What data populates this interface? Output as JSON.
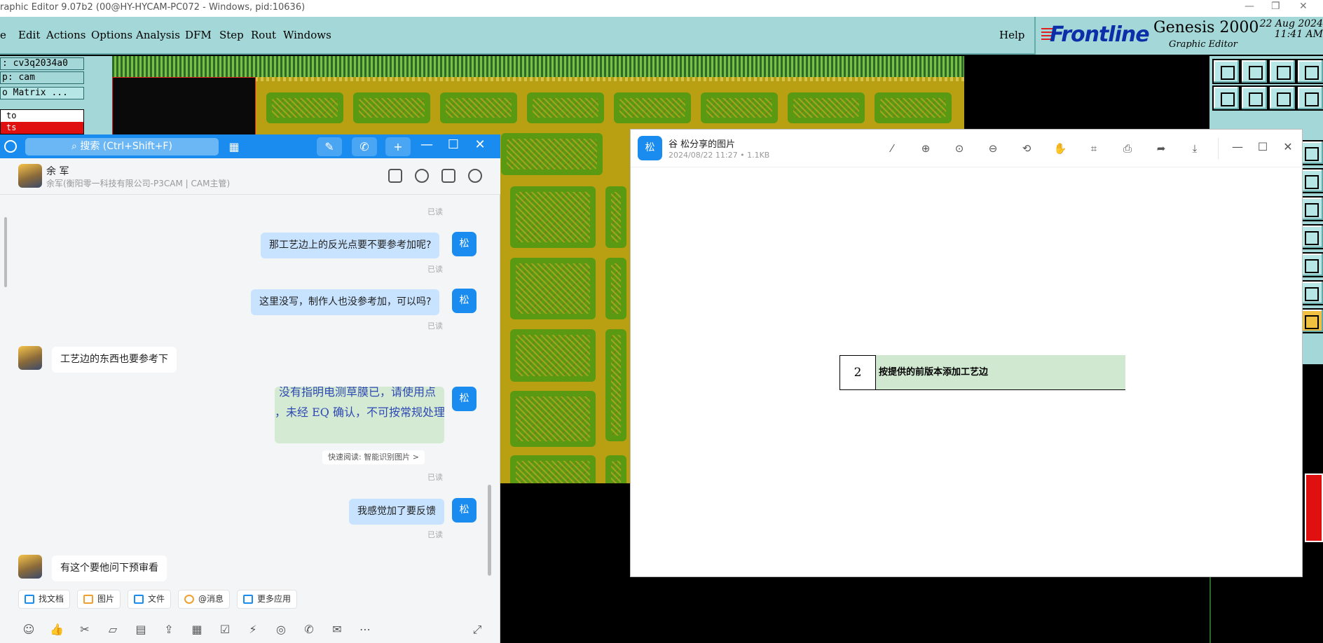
{
  "genesis": {
    "window_title": "raphic Editor 9.07b2 (00@HY-HYCAM-PC072 - Windows, pid:10636)",
    "menu": [
      "e",
      "Edit",
      "Actions",
      "Options",
      "Analysis",
      "DFM",
      "Step",
      "Rout",
      "Windows"
    ],
    "help_label": "Help",
    "brand_logo": "Frontline",
    "app_title": "Genesis 2000",
    "app_subtitle": "Graphic Editor",
    "date": "22 Aug 2024",
    "time": "11:41 AM",
    "job_field": ": cv3q2034a0",
    "step_field": "p: cam",
    "matrix_button": "o Matrix ...",
    "list_items": [
      "to",
      "ts"
    ]
  },
  "chat": {
    "search_placeholder": "搜索 (Ctrl+Shift+F)",
    "contact_name": "余 军",
    "contact_org": "余军(衡阳零一科技有限公司-P3CAM | CAM主管)",
    "read_label": "已读",
    "avatar_me": "松",
    "messages": [
      {
        "from": "me",
        "text": "那工艺边上的反光点要不要参考加呢?"
      },
      {
        "from": "me",
        "text": "这里没写，制作人也没参考加，可以吗?"
      },
      {
        "from": "other",
        "text": "工艺边的东西也要参考下"
      },
      {
        "from": "me",
        "type": "image",
        "image_text_1": "没有指明电测草膜已，请使用点",
        "image_text_2": "，未经 EQ 确认，不可按常规处理"
      },
      {
        "from": "me",
        "text": "我感觉加了要反馈"
      },
      {
        "from": "other",
        "text": "有这个要他问下预审看"
      }
    ],
    "quick_read": "快速阅读: 智能识别图片 >",
    "apps": [
      "找文档",
      "图片",
      "文件",
      "@消息",
      "更多应用"
    ]
  },
  "viewer": {
    "avatar": "松",
    "title": "谷 松分享的图片",
    "meta": "2024/08/22 11:27 • 1.1KB",
    "table": {
      "number": "2",
      "text": "按提供的前版本添加工艺边"
    }
  },
  "colors": {
    "chat_blue": "#1a8cf0",
    "genesis_teal": "#a4d7d7",
    "pcb_gold": "#b9a012",
    "pcb_green": "#5a9a12"
  }
}
